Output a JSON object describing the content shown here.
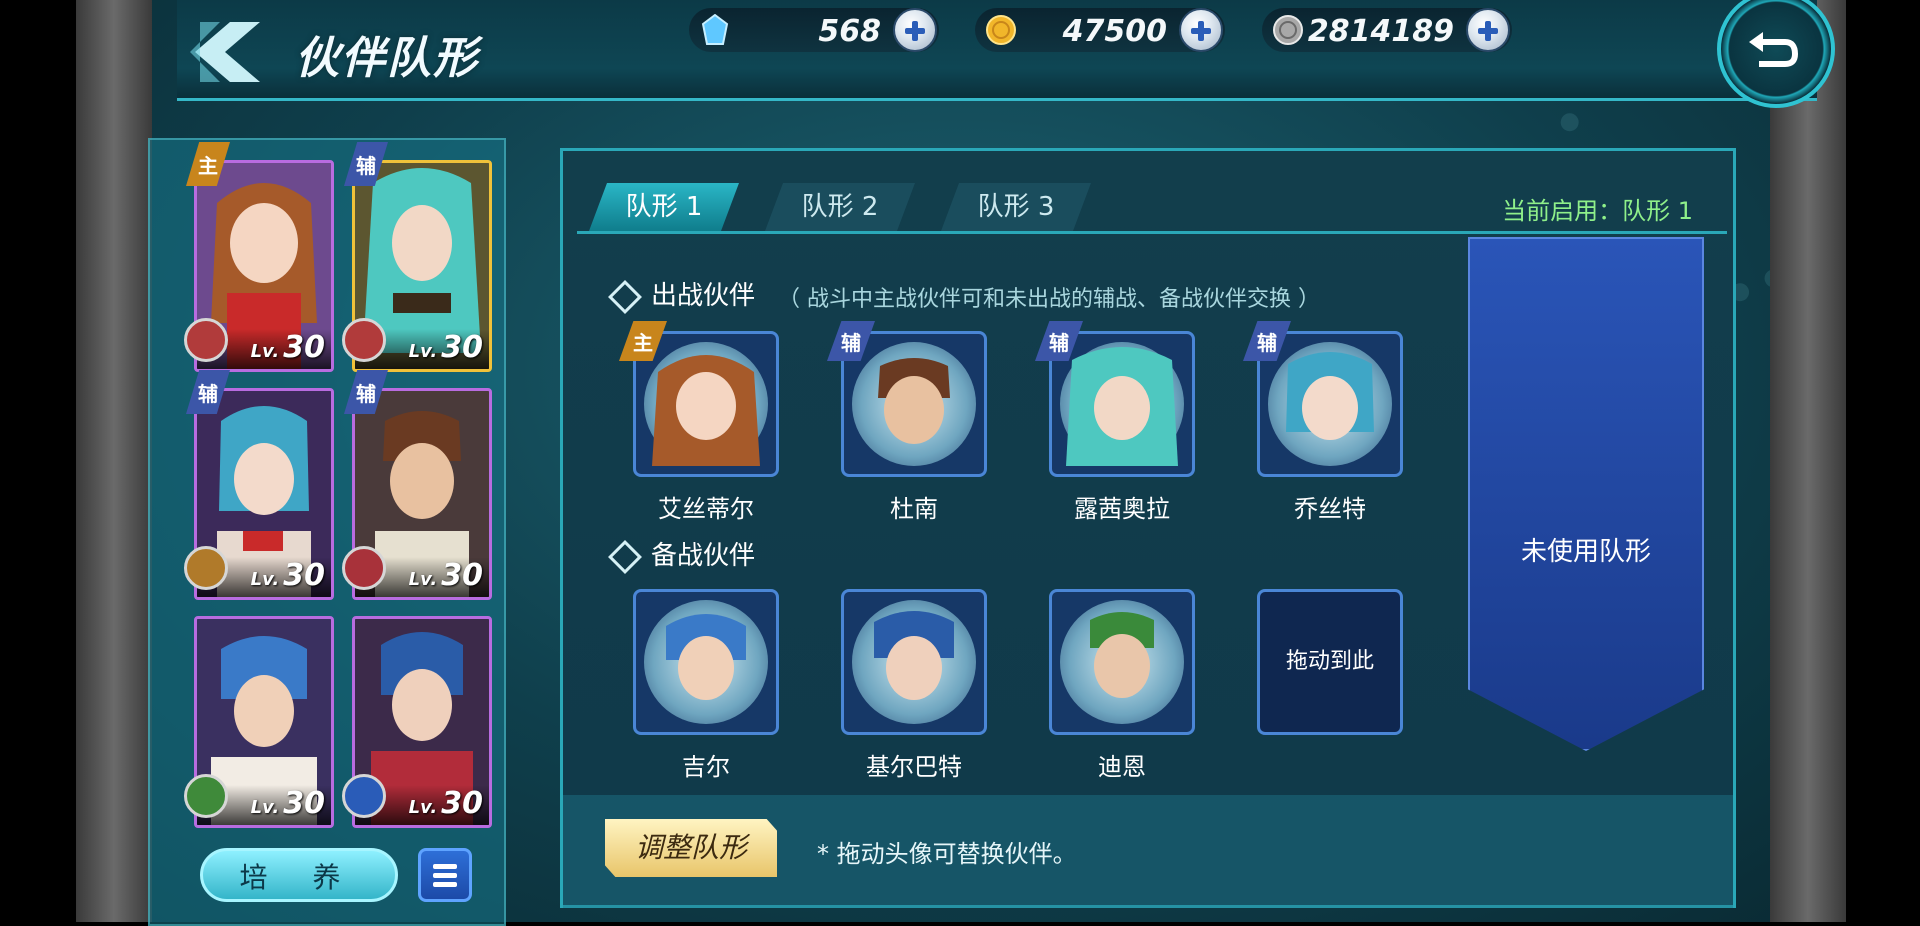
{
  "header": {
    "title": "伙伴队形",
    "currencies": [
      {
        "icon": "blue-crystal-icon",
        "value": "568"
      },
      {
        "icon": "gold-coin-icon",
        "value": "47500"
      },
      {
        "icon": "silver-coin-icon",
        "value": "2814189"
      }
    ]
  },
  "roster": {
    "characters": [
      {
        "role": "主",
        "level_prefix": "Lv.",
        "level": "30",
        "frame": "gold-purple",
        "type_icon": "sword-type-icon"
      },
      {
        "role": "辅",
        "level_prefix": "Lv.",
        "level": "30",
        "frame": "gold",
        "type_icon": "spiral-type-icon"
      },
      {
        "role": "辅",
        "level_prefix": "Lv.",
        "level": "30",
        "frame": "purple",
        "type_icon": "swirl-type-icon"
      },
      {
        "role": "辅",
        "level_prefix": "Lv.",
        "level": "30",
        "frame": "purple",
        "type_icon": "shield-type-icon"
      },
      {
        "role": "",
        "level_prefix": "Lv.",
        "level": "30",
        "frame": "purple",
        "type_icon": "leaf-type-icon"
      },
      {
        "role": "",
        "level_prefix": "Lv.",
        "level": "30",
        "frame": "purple",
        "type_icon": "vortex-type-icon"
      }
    ],
    "train_button": "培 养",
    "list_button_icon": "list-icon"
  },
  "formation": {
    "tabs": [
      "队形 1",
      "队形 2",
      "队形 3"
    ],
    "active_tab": 0,
    "current_status": "当前启用：队形 1",
    "battle_section": {
      "title": "出战伙伴",
      "note": "（ 战斗中主战伙伴可和未出战的辅战、备战伙伴交换 ）",
      "members": [
        {
          "name": "艾丝蒂尔",
          "badge": "主"
        },
        {
          "name": "杜南",
          "badge": "辅"
        },
        {
          "name": "露茜奥拉",
          "badge": "辅"
        },
        {
          "name": "乔丝特",
          "badge": "辅"
        }
      ]
    },
    "reserve_section": {
      "title": "备战伙伴",
      "members": [
        {
          "name": "吉尔"
        },
        {
          "name": "基尔巴特"
        },
        {
          "name": "迪恩"
        }
      ],
      "empty_slot_label": "拖动到此"
    },
    "unused_label": "未使用队形",
    "adjust_button": "调整队形",
    "hint": "* 拖动头像可替换伙伴。"
  },
  "colors": {
    "accent_cyan": "#2aa8b8",
    "status_green": "#8ff08a",
    "main_badge": "#c8851c",
    "support_badge": "#3c56a8"
  }
}
